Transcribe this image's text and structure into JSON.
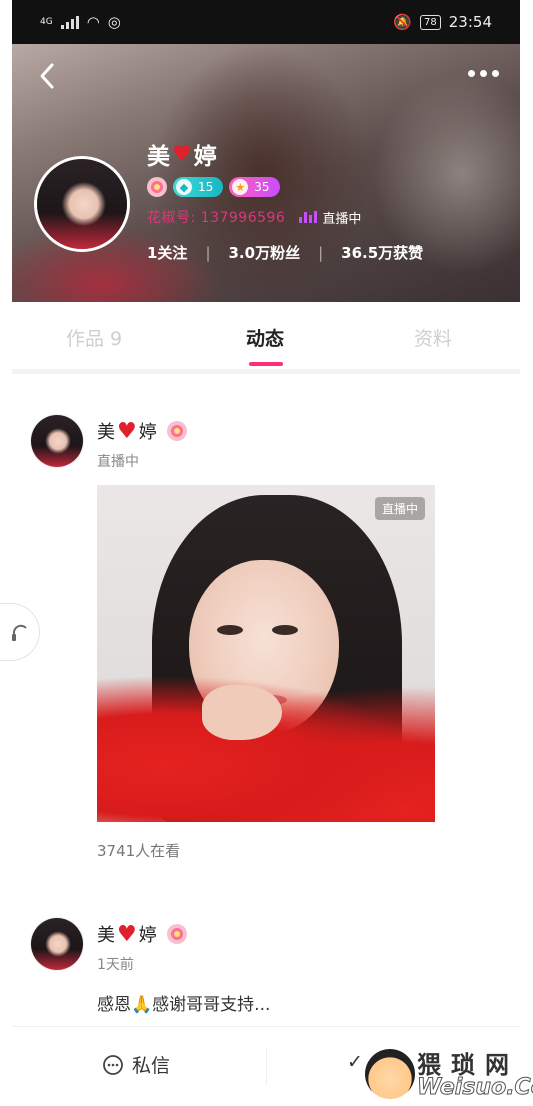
{
  "status_bar": {
    "network": "4G",
    "battery": "78",
    "time": "23:54"
  },
  "profile": {
    "nickname_part1": "美",
    "nickname_part2": "婷",
    "badge_diamond": "15",
    "badge_star": "35",
    "id_text": "花椒号: 137996596",
    "live_status": "直播中",
    "stats": {
      "following": "1关注",
      "fans": "3.0万粉丝",
      "likes": "36.5万获赞"
    }
  },
  "tabs": [
    {
      "label": "作品 9",
      "active": false
    },
    {
      "label": "动态",
      "active": true
    },
    {
      "label": "资料",
      "active": false
    }
  ],
  "posts": [
    {
      "name_part1": "美",
      "name_part2": "婷",
      "sub": "直播中",
      "live_tag": "直播中",
      "viewers": "3741人在看"
    },
    {
      "name_part1": "美",
      "name_part2": "婷",
      "sub": "1天前",
      "text": "感恩🙏感谢哥哥支持..."
    }
  ],
  "bottom_bar": {
    "message_label": "私信",
    "follow_label": "✓"
  },
  "watermark": {
    "line1": "猥琐网",
    "line2": "Weisuo.Co"
  },
  "colors": {
    "accent": "#ff2f76",
    "id_pink": "#d8397a",
    "live_purple": "#c84dff"
  }
}
